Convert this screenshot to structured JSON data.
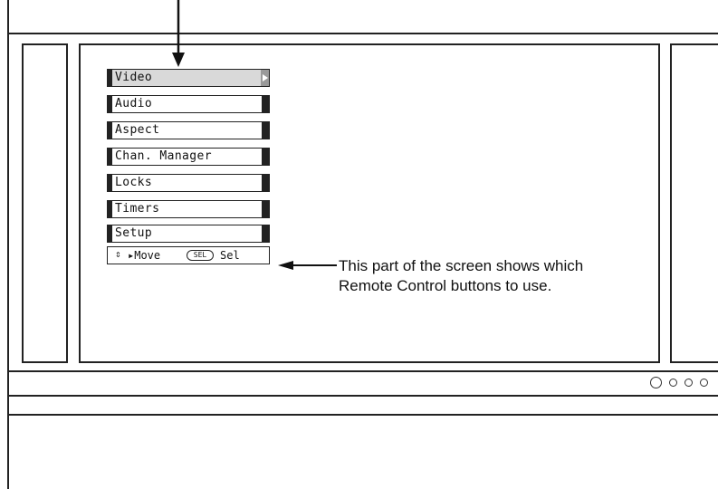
{
  "menu": {
    "items": [
      {
        "label": "Video",
        "selected": true
      },
      {
        "label": "Audio"
      },
      {
        "label": "Aspect"
      },
      {
        "label": "Chan. Manager"
      },
      {
        "label": "Locks"
      },
      {
        "label": "Timers"
      },
      {
        "label": "Setup"
      }
    ],
    "hint": {
      "updown_glyph": "⇕",
      "move_label": "▸Move",
      "sel_button": "SEL",
      "sel_label": "Sel"
    }
  },
  "callout": {
    "text": "This part of the screen shows which Remote Control buttons to use."
  },
  "indicators": {
    "count": 4
  },
  "colors": {
    "line": "#222222",
    "selected_fill": "#d9d9d9",
    "background": "#ffffff"
  }
}
